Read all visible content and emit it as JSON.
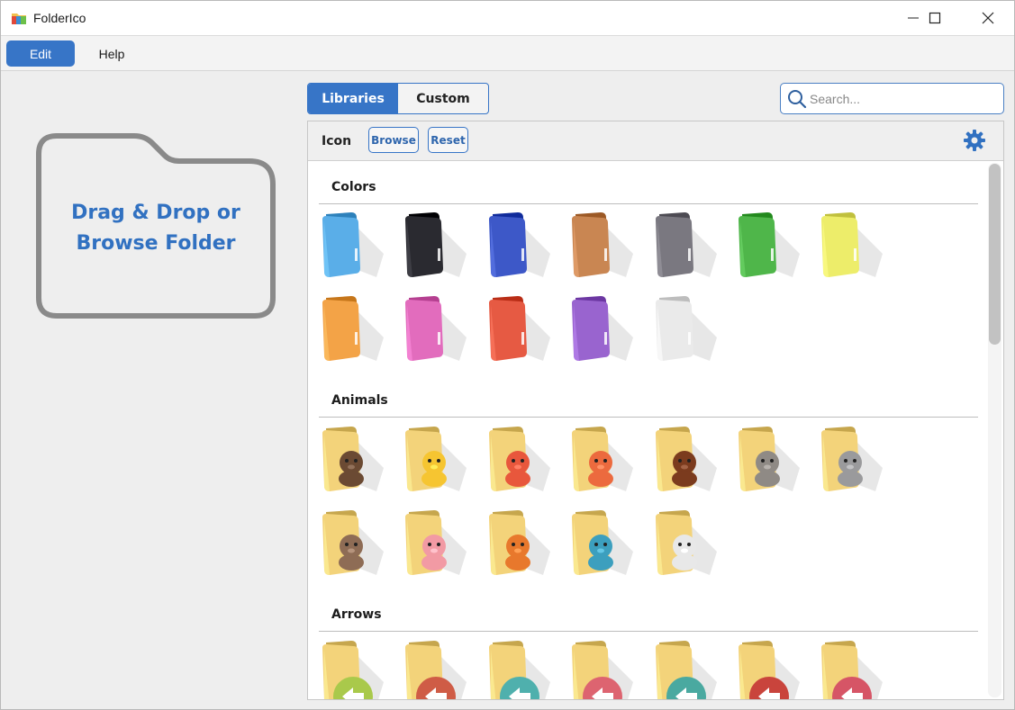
{
  "window": {
    "title": "FolderIco",
    "controls": [
      "minimize-icon",
      "maximize-icon",
      "close-icon"
    ]
  },
  "menu": {
    "edit": "Edit",
    "help": "Help"
  },
  "dropzone": {
    "line1": "Drag & Drop or",
    "line2": "Browse Folder"
  },
  "tabs": {
    "libraries": "Libraries",
    "custom": "Custom",
    "active": "libraries"
  },
  "search": {
    "placeholder": "Search...",
    "value": ""
  },
  "toolbar": {
    "icon_label": "Icon",
    "browse": "Browse",
    "reset": "Reset"
  },
  "colors_theme": {
    "accent": "#3775c7",
    "dropzone_text": "#3171c1",
    "dropzone_border": "#8a8a8a"
  },
  "sections": [
    {
      "title": "Colors",
      "kind": "color",
      "items": [
        {
          "name": "blue",
          "color": "#5aaee8"
        },
        {
          "name": "black",
          "color": "#2a2a30"
        },
        {
          "name": "dark-blue",
          "color": "#3d58c8"
        },
        {
          "name": "brown",
          "color": "#c98652"
        },
        {
          "name": "gray",
          "color": "#7a7880"
        },
        {
          "name": "green",
          "color": "#4fb64a"
        },
        {
          "name": "yellow",
          "color": "#eded6a"
        },
        {
          "name": "orange",
          "color": "#f3a347"
        },
        {
          "name": "pink",
          "color": "#e26cbd"
        },
        {
          "name": "red",
          "color": "#e65a43"
        },
        {
          "name": "purple",
          "color": "#9964cf"
        },
        {
          "name": "white",
          "color": "#eaeaea"
        }
      ]
    },
    {
      "title": "Animals",
      "kind": "animal",
      "items": [
        {
          "name": "bull",
          "color": "#6b4a33"
        },
        {
          "name": "chick",
          "color": "#f6c531"
        },
        {
          "name": "crab",
          "color": "#e8573c"
        },
        {
          "name": "fox",
          "color": "#ec6a3e"
        },
        {
          "name": "hedgehog",
          "color": "#7b3b1e"
        },
        {
          "name": "hippo",
          "color": "#8f8a85"
        },
        {
          "name": "koala",
          "color": "#9a9a9c"
        },
        {
          "name": "raccoon",
          "color": "#8e6c55"
        },
        {
          "name": "pig",
          "color": "#f29aa4"
        },
        {
          "name": "tiger",
          "color": "#e8782c"
        },
        {
          "name": "whale",
          "color": "#3c9fbe"
        },
        {
          "name": "zebra",
          "color": "#e8e8e8"
        }
      ]
    },
    {
      "title": "Arrows",
      "kind": "arrow",
      "items": [
        {
          "name": "arrow-left-lime",
          "color": "#a9c94b"
        },
        {
          "name": "arrow-left-red",
          "color": "#cf5c46"
        },
        {
          "name": "dots-teal",
          "color": "#4fb0ad"
        },
        {
          "name": "arrow-left-pink",
          "color": "#dd6470"
        },
        {
          "name": "arrow-back-teal",
          "color": "#4aa9a0"
        },
        {
          "name": "arrow-left-dark-red",
          "color": "#c9443c"
        },
        {
          "name": "chevron-left-pink",
          "color": "#d65566"
        }
      ]
    }
  ]
}
